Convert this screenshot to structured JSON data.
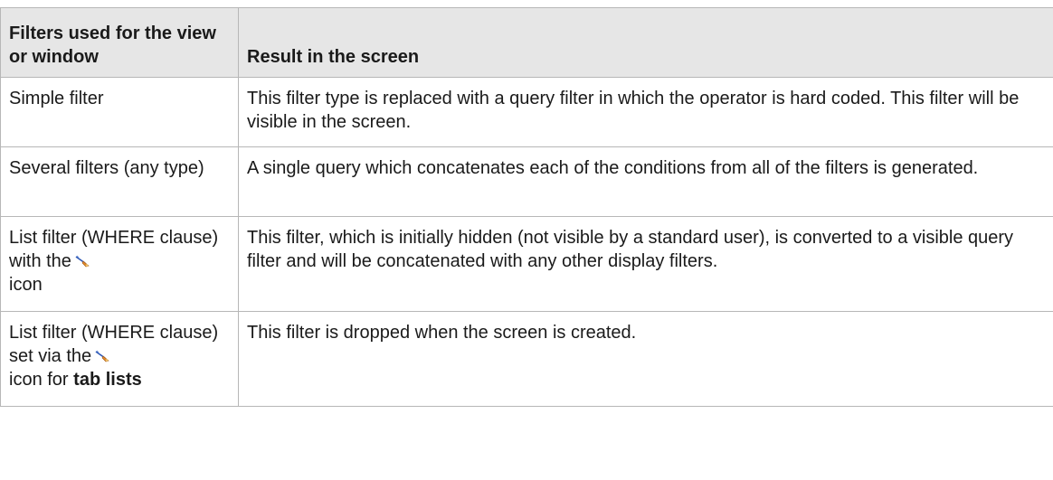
{
  "table": {
    "headers": [
      "Filters used for the view or window",
      "Result in the screen"
    ],
    "rows": [
      {
        "filter": "Simple filter",
        "result": "This filter type is replaced with a query filter in which the operator is hard coded. This filter will be visible in the screen."
      },
      {
        "filter": "Several filters (any type)",
        "result": "A single query which concatenates each of the conditions from all of the filters is generated."
      },
      {
        "filter_before_icon": "List filter (WHERE clause) with the",
        "filter_icon": "filter-wand-icon",
        "filter_after_icon": "icon",
        "result": "This filter, which is initially hidden (not visible by a standard user), is converted to a visible query filter and will be concatenated with any other display filters."
      },
      {
        "filter_before_icon": "List filter (WHERE clause) set via the",
        "filter_icon": "filter-wand-icon",
        "filter_middle": "icon for",
        "filter_bold": "tab lists",
        "result": "This filter is dropped when the screen is created."
      }
    ]
  },
  "colors": {
    "header_background": "#e6e6e6",
    "border": "#b7b7b7",
    "text": "#1a1a1a"
  }
}
